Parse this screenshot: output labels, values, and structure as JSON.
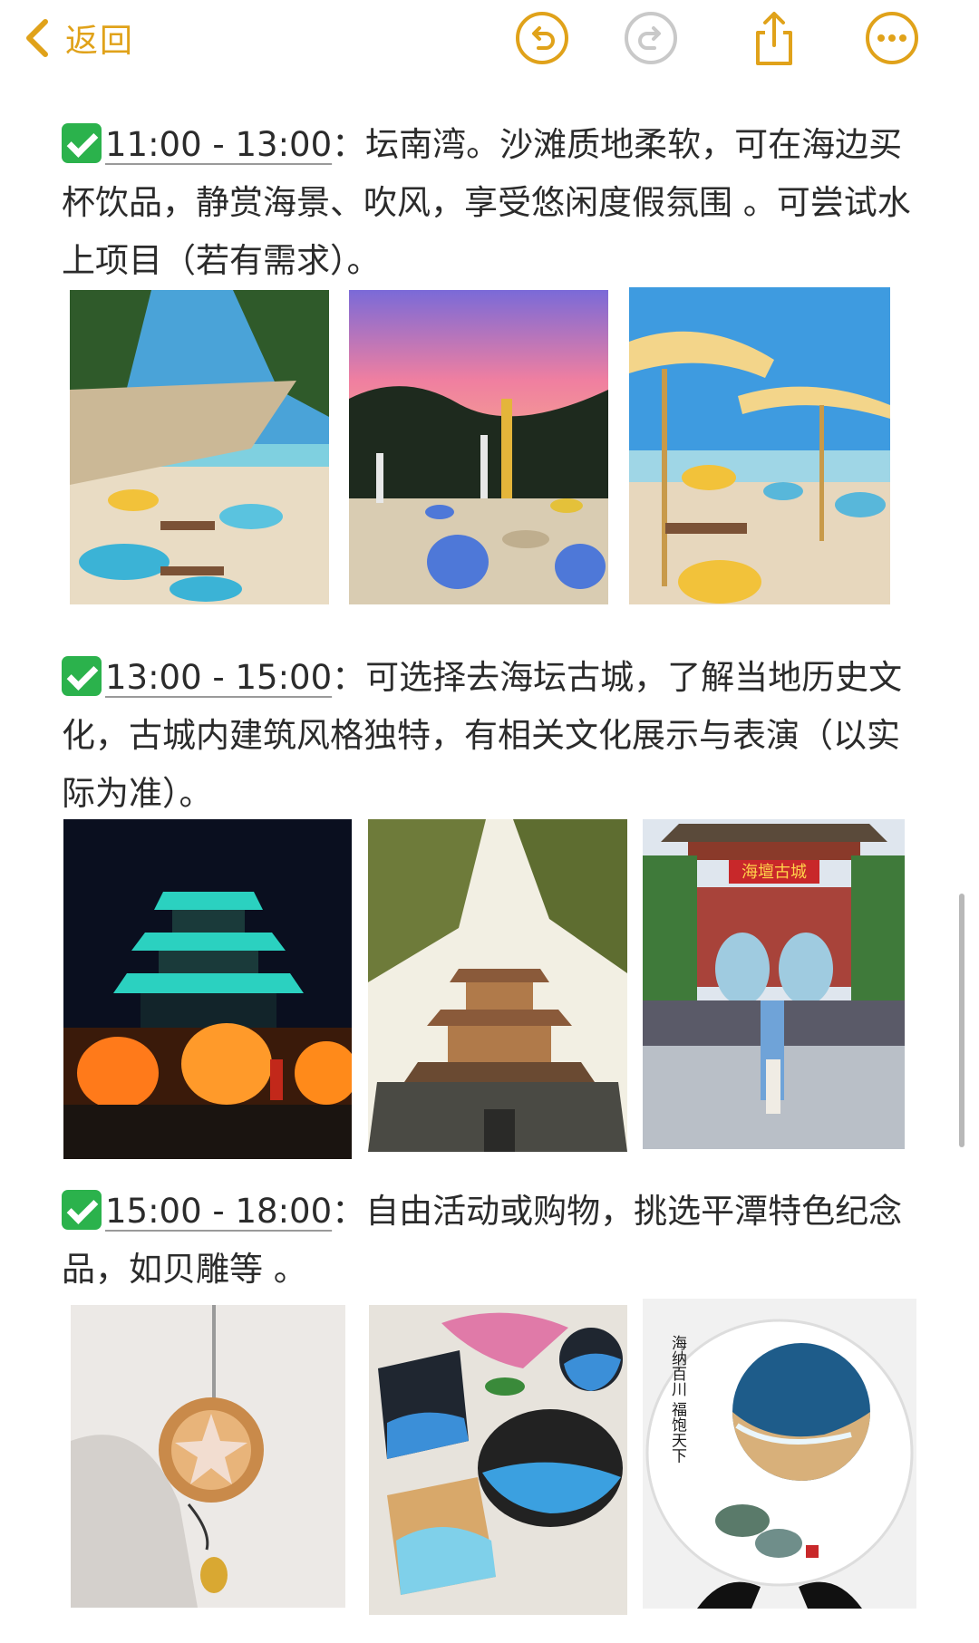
{
  "toolbar": {
    "back_label": "返回",
    "icons": [
      "chevron-left-icon",
      "undo-icon",
      "redo-icon",
      "share-icon",
      "more-icon"
    ],
    "accent_color": "#e0a21a"
  },
  "sections": [
    {
      "time": "11:00 - 13:00",
      "text": "：坛南湾。沙滩质地柔软，可在海边买杯饮品，静赏海景、吹风，享受悠闲度假氛围 。可尝试水上项目（若有需求）。"
    },
    {
      "time": "13:00 - 15:00",
      "text": "：可选择去海坛古城，了解当地历史文化，古城内建筑风格独特，有相关文化展示与表演（以实际为准）。"
    },
    {
      "time": "15:00 - 18:00",
      "text": "：自由活动或购物，挑选平潭特色纪念品，如贝雕等 。"
    }
  ],
  "photo_signs": {
    "ancient_city_gate": "海壇古城",
    "plate_calligraphy": "海纳百川 福饱天下"
  }
}
